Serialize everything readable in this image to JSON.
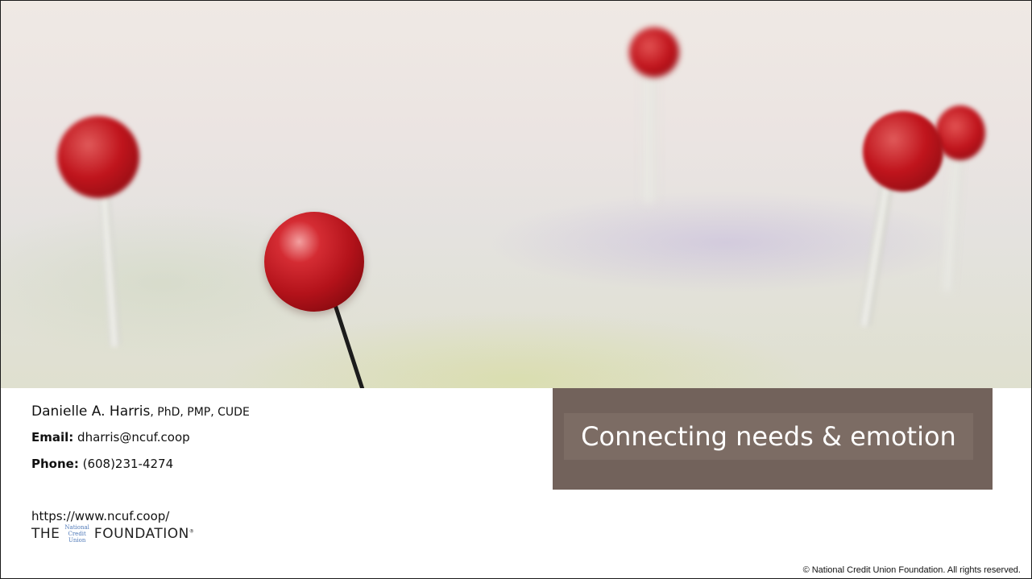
{
  "slide": {
    "title": "Connecting needs & emotion",
    "contact": {
      "name": "Danielle A. Harris",
      "credentials": ", PhD, PMP, CUDE",
      "email_label": "Email:",
      "email_value": " dharris@ncuf.coop",
      "phone_label": "Phone:",
      "phone_value": " (608)231-4274",
      "website": "https://www.ncuf.coop/"
    },
    "logo": {
      "the": "THE",
      "line1": "National",
      "line2": "Credit",
      "line3": "Union",
      "foundation": "FOUNDATION",
      "tm": "®"
    },
    "copyright": "© National Credit Union Foundation. All rights reserved.",
    "image_description_icons": [
      "map-pin-icon"
    ],
    "colors": {
      "title_box": "#72625b",
      "title_inner": "#7c6c64",
      "pin_red": "#c0141c",
      "logo_blue": "#4f79b8"
    }
  }
}
